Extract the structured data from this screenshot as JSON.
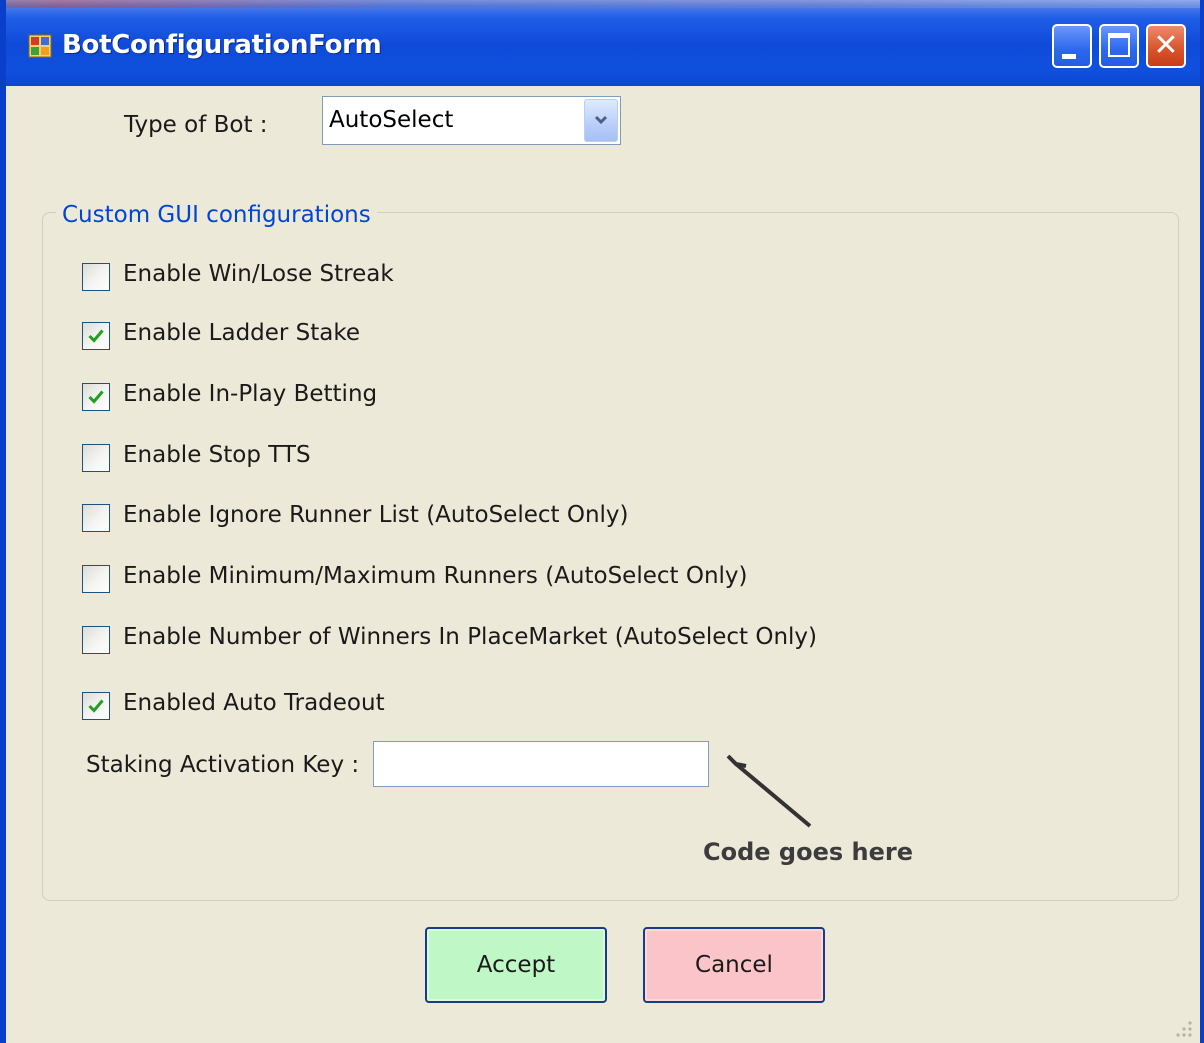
{
  "window": {
    "title": "BotConfigurationForm",
    "icons": {
      "app": "app-icon",
      "minimize": "minimize-icon",
      "maximize": "maximize-icon",
      "close": "close-icon"
    },
    "close_glyph": "✕"
  },
  "bot_type": {
    "label": "Type of Bot :",
    "selected": "AutoSelect",
    "dropdown_icon": "chevron-down-icon"
  },
  "group": {
    "title": "Custom GUI configurations",
    "checkboxes": [
      {
        "label": "Enable Win/Lose Streak",
        "checked": false
      },
      {
        "label": "Enable Ladder Stake",
        "checked": true
      },
      {
        "label": "Enable In-Play Betting",
        "checked": true
      },
      {
        "label": "Enable Stop TTS",
        "checked": false
      },
      {
        "label": "Enable Ignore Runner List (AutoSelect Only)",
        "checked": false
      },
      {
        "label": "Enable Minimum/Maximum Runners (AutoSelect Only)",
        "checked": false
      },
      {
        "label": "Enable Number of Winners In PlaceMarket (AutoSelect Only)",
        "checked": false
      },
      {
        "label": "Enabled Auto Tradeout",
        "checked": true
      }
    ],
    "staking_key": {
      "label": "Staking Activation Key :",
      "value": ""
    },
    "annotation": "Code goes here"
  },
  "buttons": {
    "accept": "Accept",
    "cancel": "Cancel"
  },
  "colors": {
    "titlebar": "#0f4ad9",
    "window_bg": "#ece9d8",
    "group_title": "#0046d5",
    "check": "#21a121",
    "accept_bg": "#bff7c6",
    "cancel_bg": "#fbc4c8"
  }
}
